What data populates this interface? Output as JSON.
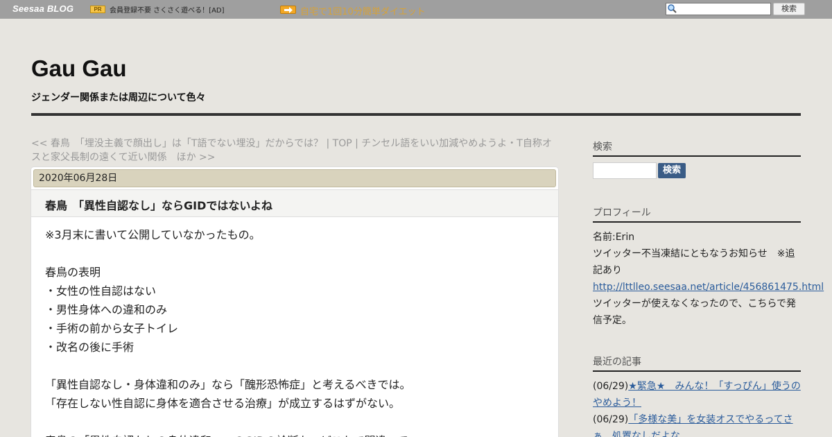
{
  "topbar": {
    "logo": "Seesaa BLOG",
    "pr_badge": "PR",
    "ad_text": "会員登録不要 さくさく遊べる！[AD]",
    "ad_link": "自宅で1回10分簡単ダイエット",
    "search_placeholder": "",
    "search_button": "検索"
  },
  "header": {
    "title": "Gau Gau",
    "subtitle": "ジェンダー関係または周辺について色々"
  },
  "nav": {
    "text": "<< 春鳥　「埋没主義で顔出し」は「T語でない埋没」だからでは？ | TOP | チンセル語をいい加減やめようよ・T自称オスと家父長制の遠くて近い関係　ほか >>"
  },
  "article": {
    "date": "2020年06月28日",
    "title": "春鳥　「異性自認なし」ならGIDではないよね",
    "body": [
      "※3月末に書いて公開していなかったもの。",
      "",
      "春鳥の表明",
      "・女性の性自認はない",
      "・男性身体への違和のみ",
      "・手術の前から女子トイレ",
      "・改名の後に手術",
      "",
      "「異性自認なし・身体違和のみ」なら「醜形恐怖症」と考えるべきでは。",
      "「存在しない性自認に身体を適合させる治療」が成立するはずがない。",
      "",
      "春鳥の「異性自認なしの身体違和」へのGIDの診断も、どこかで間違って"
    ]
  },
  "sidebar": {
    "search_heading": "検索",
    "search_button": "検索",
    "profile_heading": "プロフィール",
    "profile_name": "名前:Erin",
    "profile_notice": "ツイッター不当凍結にともなうお知らせ　※追記あり",
    "profile_link": "http://lttlleo.seesaa.net/article/456861475.html",
    "profile_note": "ツイッターが使えなくなったので、こちらで発信予定。",
    "recent_heading": "最近の記事",
    "recent": [
      {
        "date": "(06/29)",
        "title": "★緊急★　みんな！「すっぴん」使うのやめよう！"
      },
      {
        "date": "(06/29)",
        "title": "「多様な美」を女装オスでやるってさぁ　処置なしだよな"
      }
    ]
  }
}
